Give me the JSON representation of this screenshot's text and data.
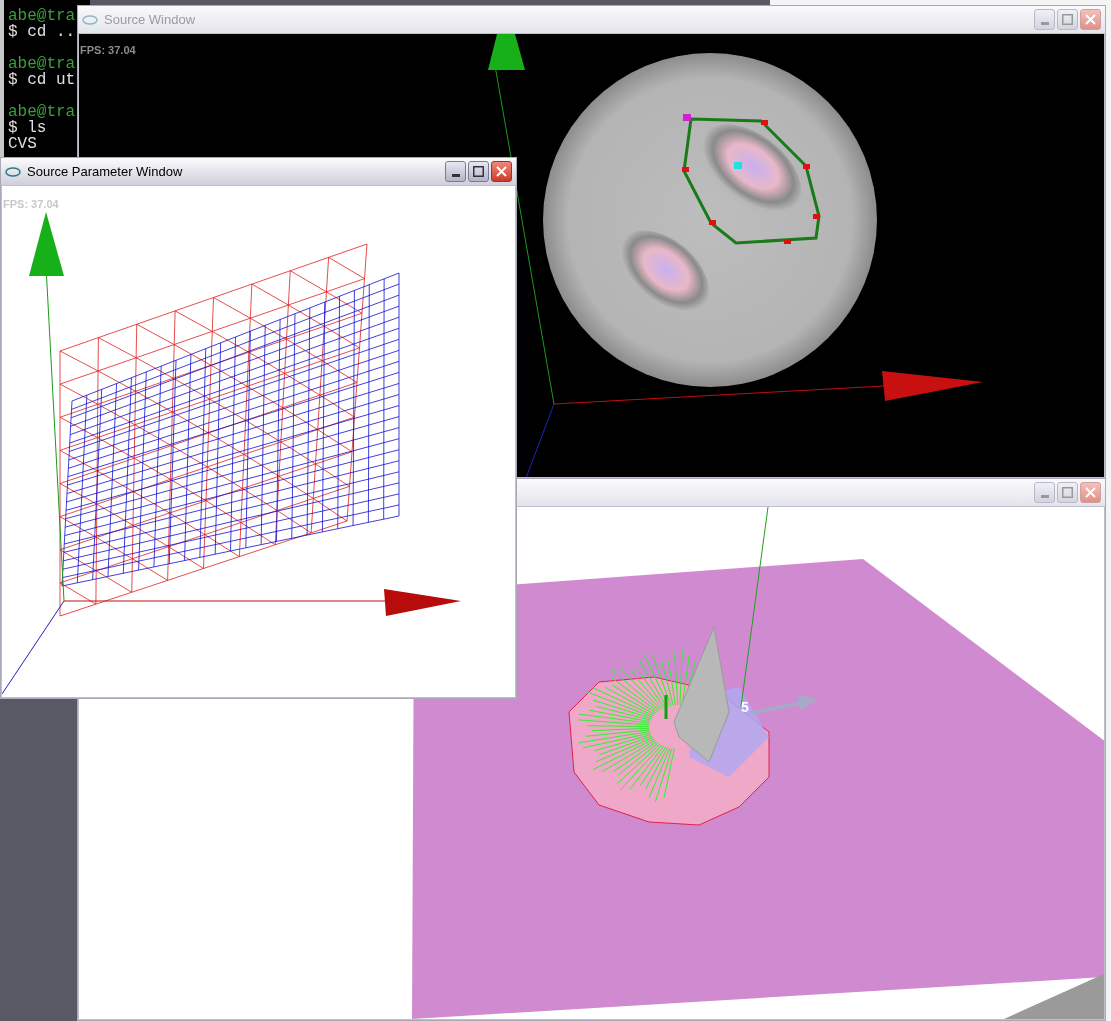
{
  "terminal": {
    "blocks": [
      {
        "prompt": "abe@tra",
        "command": "$ cd .."
      },
      {
        "prompt": "abe@tra",
        "command": "$ cd ut"
      },
      {
        "prompt": "abe@tra",
        "command": "$ ls"
      }
    ],
    "output": "CVS"
  },
  "windows": [
    {
      "kind": "source",
      "title": "Source Window",
      "active": false,
      "fps": "FPS: 37.04"
    },
    {
      "kind": "viewer",
      "active": false,
      "label": "5"
    },
    {
      "kind": "parameter",
      "title": "Source Parameter Window",
      "active": true,
      "fps": "FPS: 37.04"
    }
  ]
}
